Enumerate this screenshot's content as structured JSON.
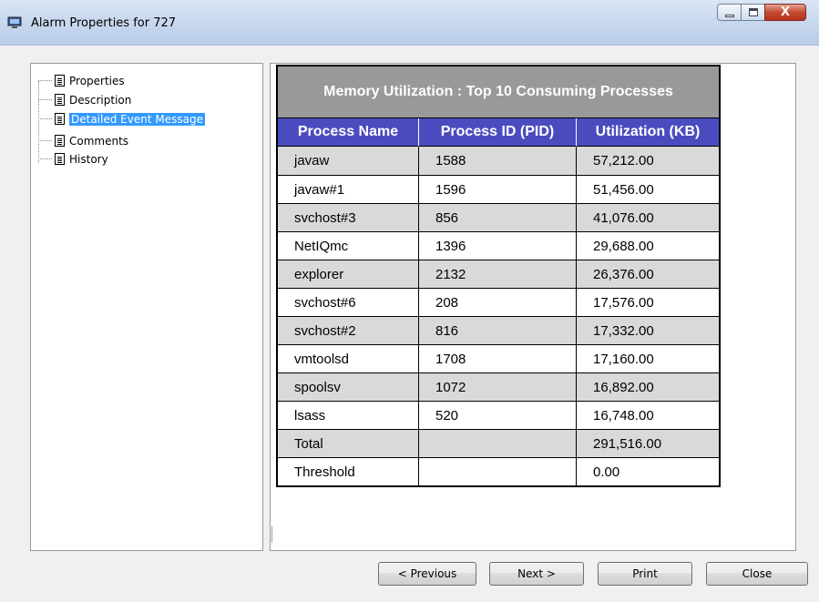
{
  "window": {
    "title": "Alarm Properties for 727",
    "icons": [
      "monitor-icon",
      "minimize-icon",
      "maximize-icon",
      "close-icon"
    ],
    "close_glyph": "X"
  },
  "tree": {
    "items": [
      {
        "label": "Properties",
        "selected": false
      },
      {
        "label": "Description",
        "selected": false
      },
      {
        "label": "Detailed Event Message",
        "selected": true
      },
      {
        "label": "Comments",
        "selected": false
      },
      {
        "label": "History",
        "selected": false
      }
    ]
  },
  "table": {
    "title": "Memory Utilization : Top 10 Consuming Processes",
    "columns": [
      "Process Name",
      "Process ID (PID)",
      "Utilization (KB)"
    ],
    "rows": [
      {
        "name": "javaw",
        "pid": "1588",
        "util": "57,212.00"
      },
      {
        "name": "javaw#1",
        "pid": "1596",
        "util": "51,456.00"
      },
      {
        "name": "svchost#3",
        "pid": "856",
        "util": "41,076.00"
      },
      {
        "name": "NetIQmc",
        "pid": "1396",
        "util": "29,688.00"
      },
      {
        "name": "explorer",
        "pid": "2132",
        "util": "26,376.00"
      },
      {
        "name": "svchost#6",
        "pid": "208",
        "util": "17,576.00"
      },
      {
        "name": "svchost#2",
        "pid": "816",
        "util": "17,332.00"
      },
      {
        "name": "vmtoolsd",
        "pid": "1708",
        "util": "17,160.00"
      },
      {
        "name": "spoolsv",
        "pid": "1072",
        "util": "16,892.00"
      },
      {
        "name": "lsass",
        "pid": "520",
        "util": "16,748.00"
      },
      {
        "name": "Total",
        "pid": "",
        "util": "291,516.00"
      },
      {
        "name": "Threshold",
        "pid": "",
        "util": "0.00"
      }
    ],
    "colors": {
      "title_bg": "#999999",
      "header_bg": "#4b4bc0",
      "shade": "#d9d9d9"
    }
  },
  "buttons": {
    "previous": "< Previous",
    "next": "Next >",
    "print": "Print",
    "close": "Close"
  }
}
